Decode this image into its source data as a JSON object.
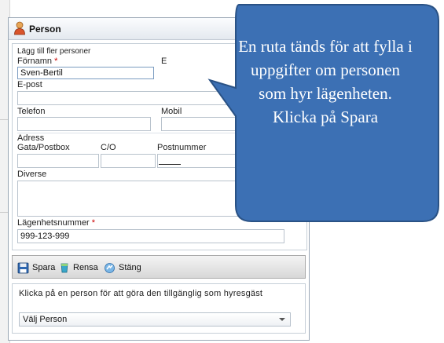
{
  "dialog": {
    "title": "Person",
    "section_heading": "Lägg till fler personer",
    "fields": {
      "firstname_label": "Förnamn",
      "required_mark": "*",
      "firstname_value": "Sven-Bertil",
      "lastname_label_partial": "E",
      "email_label": "E-post",
      "phone_label": "Telefon",
      "mobile_label": "Mobil",
      "address_label": "Adress",
      "street_label": "Gata/Postbox",
      "co_label": "C/O",
      "postal_label": "Postnummer",
      "misc_label": "Diverse",
      "apartment_label": "Lägenhetsnummer",
      "apartment_value": "999-123-999"
    },
    "toolbar": {
      "save_label": "Spara",
      "clear_label": "Rensa",
      "close_label": "Stäng"
    },
    "lower": {
      "hint": "Klicka på en person för att göra den tillgänglig som hyresgäst",
      "select_value": "Välj Person"
    }
  },
  "callout": {
    "text": "En ruta tänds för att fylla i uppgifter om personen som hyr lägenheten. Klicka på Spara",
    "fill_color": "#3c70b4",
    "stroke_color": "#2a5285"
  },
  "icons": {
    "title": "person-icon",
    "save": "floppy-disk-icon",
    "clear": "eraser-icon",
    "close": "close-arrow-icon"
  }
}
